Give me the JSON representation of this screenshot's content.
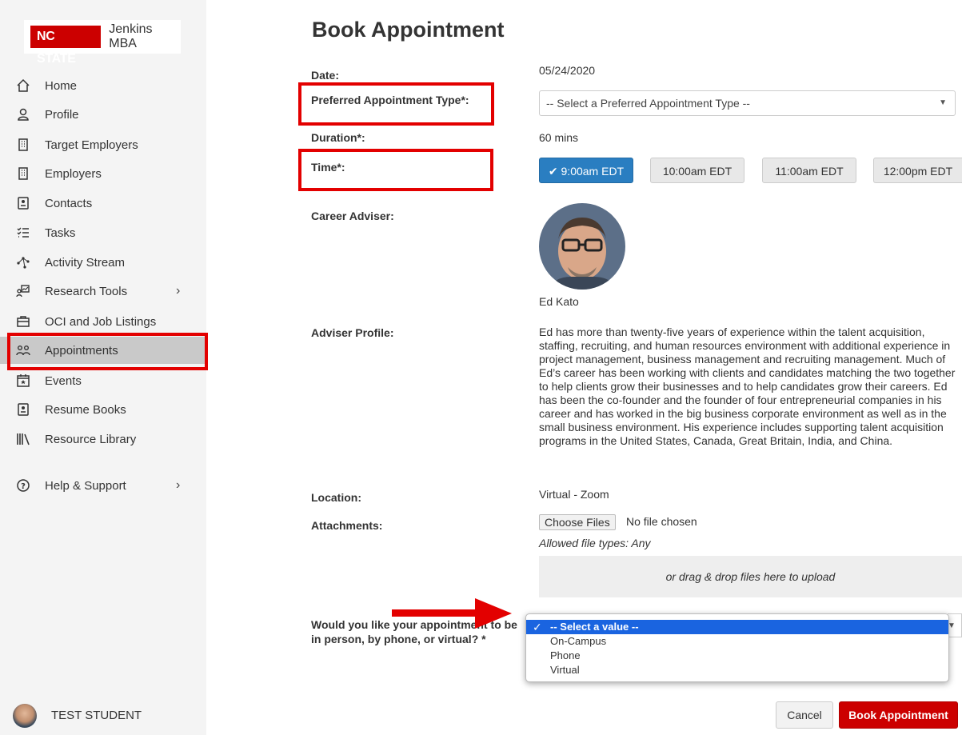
{
  "sidebar": {
    "logo_brand": "NC STATE",
    "logo_program": "Jenkins MBA",
    "items": [
      {
        "label": "Home",
        "icon": "home-icon"
      },
      {
        "label": "Profile",
        "icon": "user-icon"
      },
      {
        "label": "Target Employers",
        "icon": "building-icon"
      },
      {
        "label": "Employers",
        "icon": "building-icon"
      },
      {
        "label": "Contacts",
        "icon": "contact-card-icon"
      },
      {
        "label": "Tasks",
        "icon": "checklist-icon"
      },
      {
        "label": "Activity Stream",
        "icon": "network-icon"
      },
      {
        "label": "Research Tools",
        "icon": "chart-person-icon"
      },
      {
        "label": "OCI and Job Listings",
        "icon": "briefcase-icon"
      },
      {
        "label": "Appointments",
        "icon": "people-icon"
      },
      {
        "label": "Events",
        "icon": "calendar-star-icon"
      },
      {
        "label": "Resume Books",
        "icon": "resume-icon"
      },
      {
        "label": "Resource Library",
        "icon": "library-icon"
      },
      {
        "label": "Help & Support",
        "icon": "help-icon"
      }
    ],
    "chevron": "›",
    "user_name": "TEST STUDENT"
  },
  "main": {
    "title": "Book Appointment",
    "date_label": "Date:",
    "date_value": "05/24/2020",
    "type_label": "Preferred Appointment Type*:",
    "type_placeholder": "-- Select a Preferred Appointment Type --",
    "duration_label": "Duration*:",
    "duration_value": "60 mins",
    "time_label": "Time*:",
    "time_slots": [
      "9:00am EDT",
      "10:00am EDT",
      "11:00am EDT",
      "12:00pm EDT"
    ],
    "selected_slot": "9:00am EDT",
    "adviser_label": "Career Adviser:",
    "adviser_name": "Ed Kato",
    "profile_label": "Adviser Profile:",
    "profile_text": "Ed has more than twenty-five years of experience within the talent acquisition, staffing, recruiting, and human resources environment with additional experience in project management, business management and recruiting management. Much of Ed’s career has been working with clients and candidates matching the two together to help clients grow their businesses and to help candidates grow their careers. Ed has been the co-founder and the founder of four entrepreneurial companies in his career and has worked in the big business corporate environment as well as in the small business environment. His experience includes supporting talent acquisition programs in the United States, Canada, Great Britain, India, and China.",
    "location_label": "Location:",
    "location_value": "Virtual - Zoom",
    "attachments_label": "Attachments:",
    "choose_files": "Choose Files",
    "no_file": "No file chosen",
    "allowed_types": "Allowed file types: Any",
    "drop_text": "or drag & drop files here to upload",
    "question_label": "Would you like your appointment to be in person, by phone, or virtual? *",
    "options": [
      "-- Select a value --",
      "On-Campus",
      "Phone",
      "Virtual"
    ],
    "cancel": "Cancel",
    "book": "Book Appointment"
  },
  "colors": {
    "highlight": "#e30000",
    "brand_red": "#cc0000",
    "slot_active": "#2a7ec1",
    "option_selected": "#1a64e0"
  }
}
